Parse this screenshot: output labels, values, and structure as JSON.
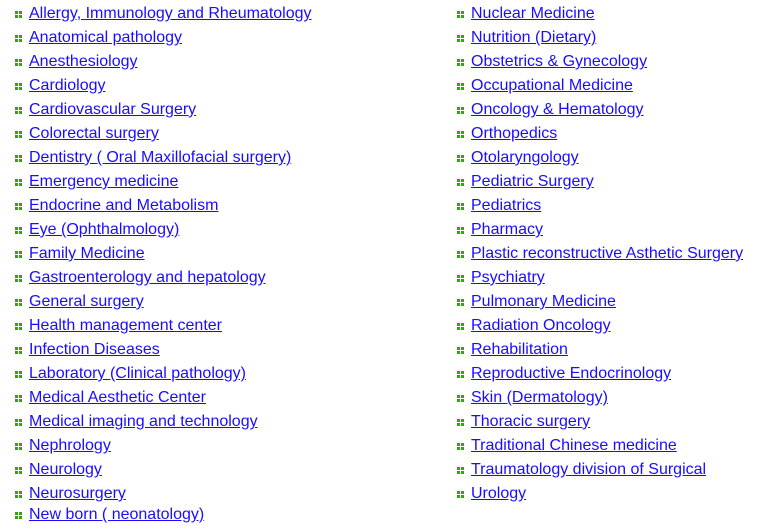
{
  "colors": {
    "link": "#1a0dff",
    "bullet": "#3aa010"
  },
  "bullet_icon": "green-four-square-bullet",
  "left_column": [
    "Allergy, Immunology and Rheumatology",
    "Anatomical pathology",
    "Anesthesiology",
    "Cardiology",
    "Cardiovascular Surgery",
    "Colorectal surgery",
    "Dentistry ( Oral Maxillofacial surgery)",
    "Emergency medicine",
    "Endocrine and Metabolism",
    "Eye (Ophthalmology)",
    "Family Medicine",
    "Gastroenterology and hepatology",
    "General surgery",
    "Health management center",
    "Infection Diseases",
    "Laboratory (Clinical pathology)",
    "Medical Aesthetic Center",
    "Medical imaging and technology",
    "Nephrology",
    "Neurology",
    "Neurosurgery",
    "New born ( neonatology)"
  ],
  "right_column": [
    "Nuclear Medicine",
    "Nutrition (Dietary)",
    "Obstetrics & Gynecology",
    "Occupational Medicine",
    "Oncology & Hematology",
    "Orthopedics",
    "Otolaryngology",
    "Pediatric Surgery",
    "Pediatrics",
    "Pharmacy",
    "Plastic reconstructive Asthetic Surgery",
    "Psychiatry",
    "Pulmonary Medicine",
    "Radiation Oncology",
    "Rehabilitation",
    "Reproductive Endocrinology",
    "Skin (Dermatology)",
    "Thoracic surgery",
    "Traditional Chinese medicine",
    "Traumatology division of Surgical",
    "Urology"
  ]
}
